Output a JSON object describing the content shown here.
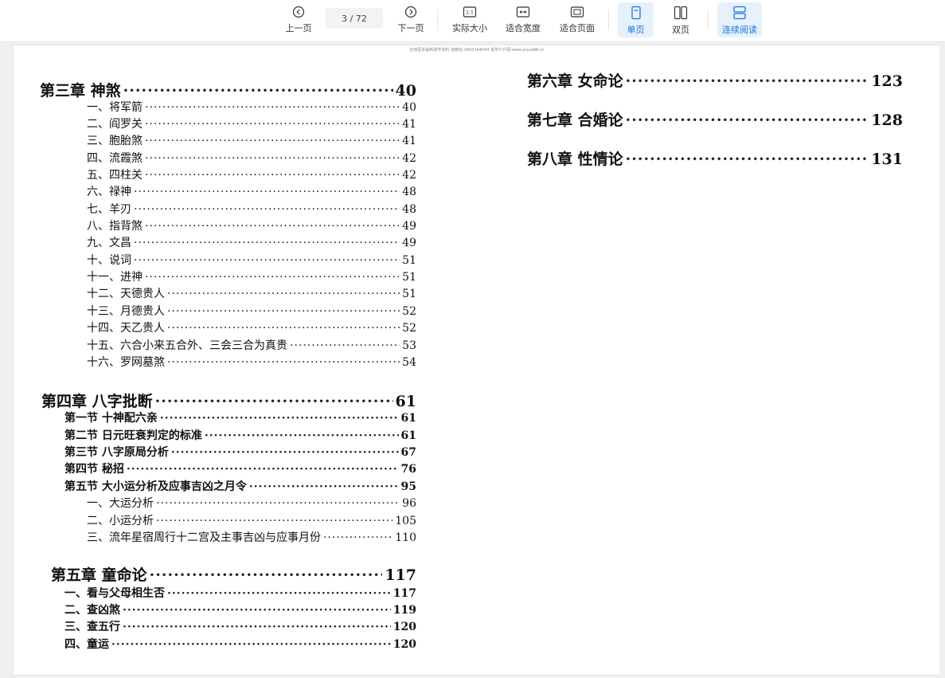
{
  "toolbar": {
    "prev": "上一页",
    "page_indicator": "3 / 72",
    "next": "下一页",
    "actual_size": "实际大小",
    "fit_width": "适合宽度",
    "fit_page": "适合页面",
    "single_page": "单页",
    "double_page": "双页",
    "continuous": "连续阅读"
  },
  "page": {
    "watermark": "在知更多最新易学资料 加微信:3450344044 易学户户网:www.yixue88.cn",
    "left_column": [
      {
        "title": "第三章 神煞",
        "page": "40",
        "level": "h1"
      },
      {
        "title": "一、将军箭",
        "page": "40",
        "level": "it"
      },
      {
        "title": "二、阎罗关",
        "page": "41",
        "level": "it"
      },
      {
        "title": "三、胞胎煞",
        "page": "41",
        "level": "it"
      },
      {
        "title": "四、流霞煞",
        "page": "42",
        "level": "it"
      },
      {
        "title": "五、四柱关",
        "page": "42",
        "level": "it"
      },
      {
        "title": "六、禄神",
        "page": "48",
        "level": "it"
      },
      {
        "title": "七、羊刃",
        "page": "48",
        "level": "it"
      },
      {
        "title": "八、指背煞",
        "page": "49",
        "level": "it"
      },
      {
        "title": "九、文昌",
        "page": "49",
        "level": "it"
      },
      {
        "title": "十、说词",
        "page": "51",
        "level": "it"
      },
      {
        "title": "十一、进神",
        "page": "51",
        "level": "it"
      },
      {
        "title": "十二、天德贵人",
        "page": "51",
        "level": "it"
      },
      {
        "title": "十三、月德贵人",
        "page": "52",
        "level": "it"
      },
      {
        "title": "十四、天乙贵人",
        "page": "52",
        "level": "it"
      },
      {
        "title": "十五、六合小来五合外、三会三合为真贵",
        "page": "53",
        "level": "it"
      },
      {
        "title": "十六、罗网墓煞",
        "page": "54",
        "level": "it"
      },
      {
        "title": "第四章 八字批断",
        "page": "61",
        "level": "h1"
      },
      {
        "title": "第一节 十神配六亲",
        "page": "61",
        "level": "h2"
      },
      {
        "title": "第二节 日元旺衰判定的标准",
        "page": "61",
        "level": "h2"
      },
      {
        "title": "第三节 八字原局分析",
        "page": "67",
        "level": "h2"
      },
      {
        "title": "第四节 秘招",
        "page": "76",
        "level": "h2"
      },
      {
        "title": "第五节 大小运分析及应事吉凶之月令",
        "page": "95",
        "level": "h2"
      },
      {
        "title": "一、大运分析",
        "page": "96",
        "level": "it"
      },
      {
        "title": "二、小运分析",
        "page": "105",
        "level": "it"
      },
      {
        "title": "三、流年星宿周行十二宫及主事吉凶与应事月份",
        "page": "110",
        "level": "it"
      },
      {
        "title": "第五章 童命论",
        "page": "117",
        "level": "h1"
      },
      {
        "title": "一、看与父母相生否",
        "page": "117",
        "level": "h2"
      },
      {
        "title": "二、查凶煞",
        "page": "119",
        "level": "h2"
      },
      {
        "title": "三、查五行",
        "page": "120",
        "level": "h2"
      },
      {
        "title": "四、童运",
        "page": "120",
        "level": "h2"
      }
    ],
    "right_column": [
      {
        "title": "第六章 女命论",
        "page": "123",
        "level": "h1"
      },
      {
        "title": "第七章 合婚论",
        "page": "128",
        "level": "h1"
      },
      {
        "title": "第八章 性情论",
        "page": "131",
        "level": "h1"
      }
    ]
  },
  "colors": {
    "accent": "#1a73e8",
    "active_bg": "#e6f1fb",
    "text": "#111111"
  }
}
